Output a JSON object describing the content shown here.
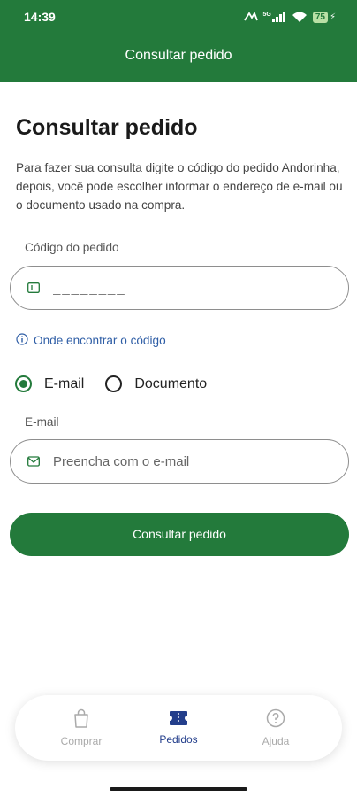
{
  "status_bar": {
    "time": "14:39",
    "network": "5G",
    "battery_level": "75",
    "icons": [
      "nfc-icon",
      "signal-icon",
      "wifi-icon",
      "battery-icon",
      "charging-icon"
    ]
  },
  "header": {
    "title": "Consultar pedido"
  },
  "page": {
    "heading": "Consultar pedido",
    "intro": "Para fazer sua consulta digite o código do pedido Andorinha, depois, você pode escolher informar o endereço de e-mail ou o documento usado na compra."
  },
  "order_code": {
    "label": "Código do pedido",
    "placeholder": "________",
    "icon": "id-card-icon"
  },
  "help_link": {
    "label": "Onde encontrar o código",
    "icon": "info-icon"
  },
  "contact_type": {
    "options": [
      {
        "label": "E-mail",
        "selected": true
      },
      {
        "label": "Documento",
        "selected": false
      }
    ]
  },
  "email": {
    "label": "E-mail",
    "placeholder": "Preencha com o e-mail",
    "icon": "mail-icon"
  },
  "submit": {
    "label": "Consultar pedido"
  },
  "bottom_nav": {
    "items": [
      {
        "label": "Comprar",
        "icon": "shopping-bag-icon",
        "active": false
      },
      {
        "label": "Pedidos",
        "icon": "ticket-icon",
        "active": true
      },
      {
        "label": "Ajuda",
        "icon": "help-circle-icon",
        "active": false
      }
    ]
  },
  "colors": {
    "primary": "#237a3b",
    "link": "#2f5ea6",
    "nav_active": "#233e8b",
    "nav_inactive": "#aaaaaa"
  }
}
